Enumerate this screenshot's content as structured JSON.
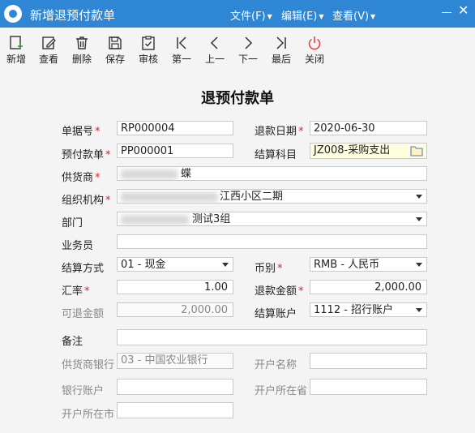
{
  "window": {
    "title": "新增退预付款单"
  },
  "menu": [
    {
      "label": "文件(F)"
    },
    {
      "label": "编辑(E)"
    },
    {
      "label": "查看(V)"
    }
  ],
  "toolbar": [
    {
      "label": "新增",
      "icon": "add-doc-icon"
    },
    {
      "label": "查看",
      "icon": "edit-icon"
    },
    {
      "label": "删除",
      "icon": "trash-icon"
    },
    {
      "label": "保存",
      "icon": "save-icon"
    },
    {
      "label": "审核",
      "icon": "audit-icon"
    },
    {
      "label": "第一",
      "icon": "first-icon"
    },
    {
      "label": "上一",
      "icon": "prev-icon"
    },
    {
      "label": "下一",
      "icon": "next-icon"
    },
    {
      "label": "最后",
      "icon": "last-icon"
    },
    {
      "label": "关闭",
      "icon": "power-icon"
    }
  ],
  "form": {
    "title": "退预付款单",
    "doc_no": {
      "label": "单据号",
      "value": "RP000004"
    },
    "refund_date": {
      "label": "退款日期",
      "value": "2020-06-30"
    },
    "prepay_no": {
      "label": "预付款单",
      "value": "PP000001"
    },
    "account_subject": {
      "label": "结算科目",
      "value": "JZ008-采购支出"
    },
    "supplier": {
      "label": "供货商",
      "value": "蝶"
    },
    "org": {
      "label": "组织机构",
      "value": "江西小区二期"
    },
    "dept": {
      "label": "部门",
      "value": "测试3组"
    },
    "salesman": {
      "label": "业务员",
      "value": ""
    },
    "settle_method": {
      "label": "结算方式",
      "value": "01 - 现金"
    },
    "currency": {
      "label": "币别",
      "value": "RMB - 人民币"
    },
    "rate": {
      "label": "汇率",
      "value": "1.00"
    },
    "refund_amount": {
      "label": "退款金额",
      "value": "2,000.00"
    },
    "refundable_amount": {
      "label": "可退金额",
      "value": "2,000.00"
    },
    "settle_account": {
      "label": "结算账户",
      "value": "1112 - 招行账户"
    },
    "remark": {
      "label": "备注",
      "value": ""
    },
    "supplier_bank": {
      "label": "供货商银行",
      "value": "03 - 中国农业银行"
    },
    "account_name": {
      "label": "开户名称",
      "value": ""
    },
    "bank_account": {
      "label": "银行账户",
      "value": ""
    },
    "bank_province": {
      "label": "开户所在省",
      "value": ""
    },
    "bank_city": {
      "label": "开户所在市",
      "value": ""
    }
  },
  "colors": {
    "titlebar": "#2f86d4",
    "required": "#d9252a",
    "close_icon": "#e04848"
  }
}
